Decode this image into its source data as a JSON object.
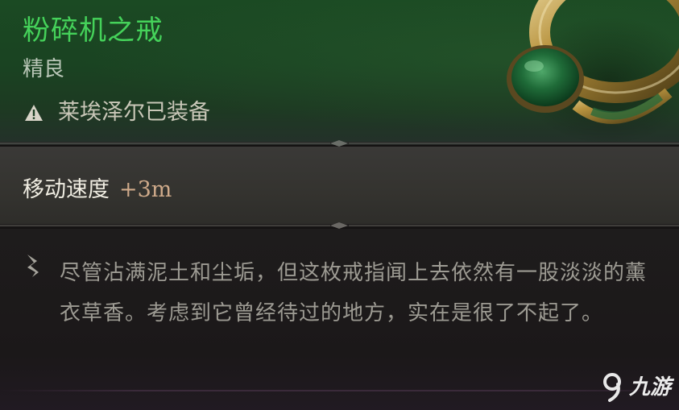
{
  "item": {
    "name": "粉碎机之戒",
    "rarity": "精良",
    "equipped_by": "莱埃泽尔已装备",
    "image_icon": "jade-ring"
  },
  "stats": {
    "label": "移动速度",
    "value": "+3m"
  },
  "description": {
    "icon": "feather-quill-icon",
    "text": "尽管沾满泥土和尘垢，但这枚戒指闻上去依然有一股淡淡的薰衣草香。考虑到它曾经待过的地方，实在是很了不起了。"
  },
  "watermark": {
    "text": "九游"
  },
  "colors": {
    "name": "#45d25a",
    "header_bg": "#1b4a23",
    "stat_value": "#cfaa8a",
    "description_text": "#9d9b93"
  }
}
